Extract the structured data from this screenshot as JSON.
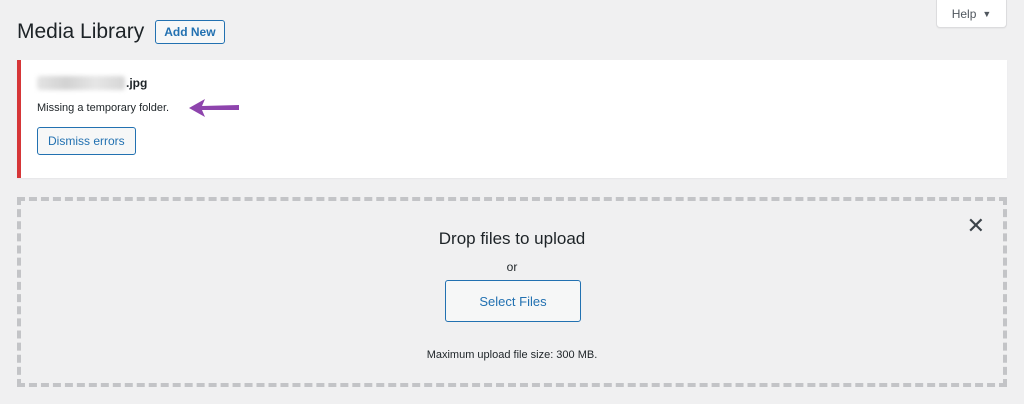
{
  "help_tab": {
    "label": "Help",
    "caret": "▼"
  },
  "header": {
    "title": "Media Library",
    "add_new_label": "Add New"
  },
  "notice": {
    "file_suffix": ".jpg",
    "error_message": "Missing a temporary folder.",
    "dismiss_label": "Dismiss errors",
    "border_color": "#d63638",
    "annotation_arrow_color": "#8e44ad"
  },
  "uploader": {
    "close_glyph": "✕",
    "drop_title": "Drop files to upload",
    "or_text": "or",
    "select_files_label": "Select Files",
    "max_size_text": "Maximum upload file size: 300 MB."
  },
  "colors": {
    "accent": "#2271b1",
    "background": "#f0f0f1"
  }
}
